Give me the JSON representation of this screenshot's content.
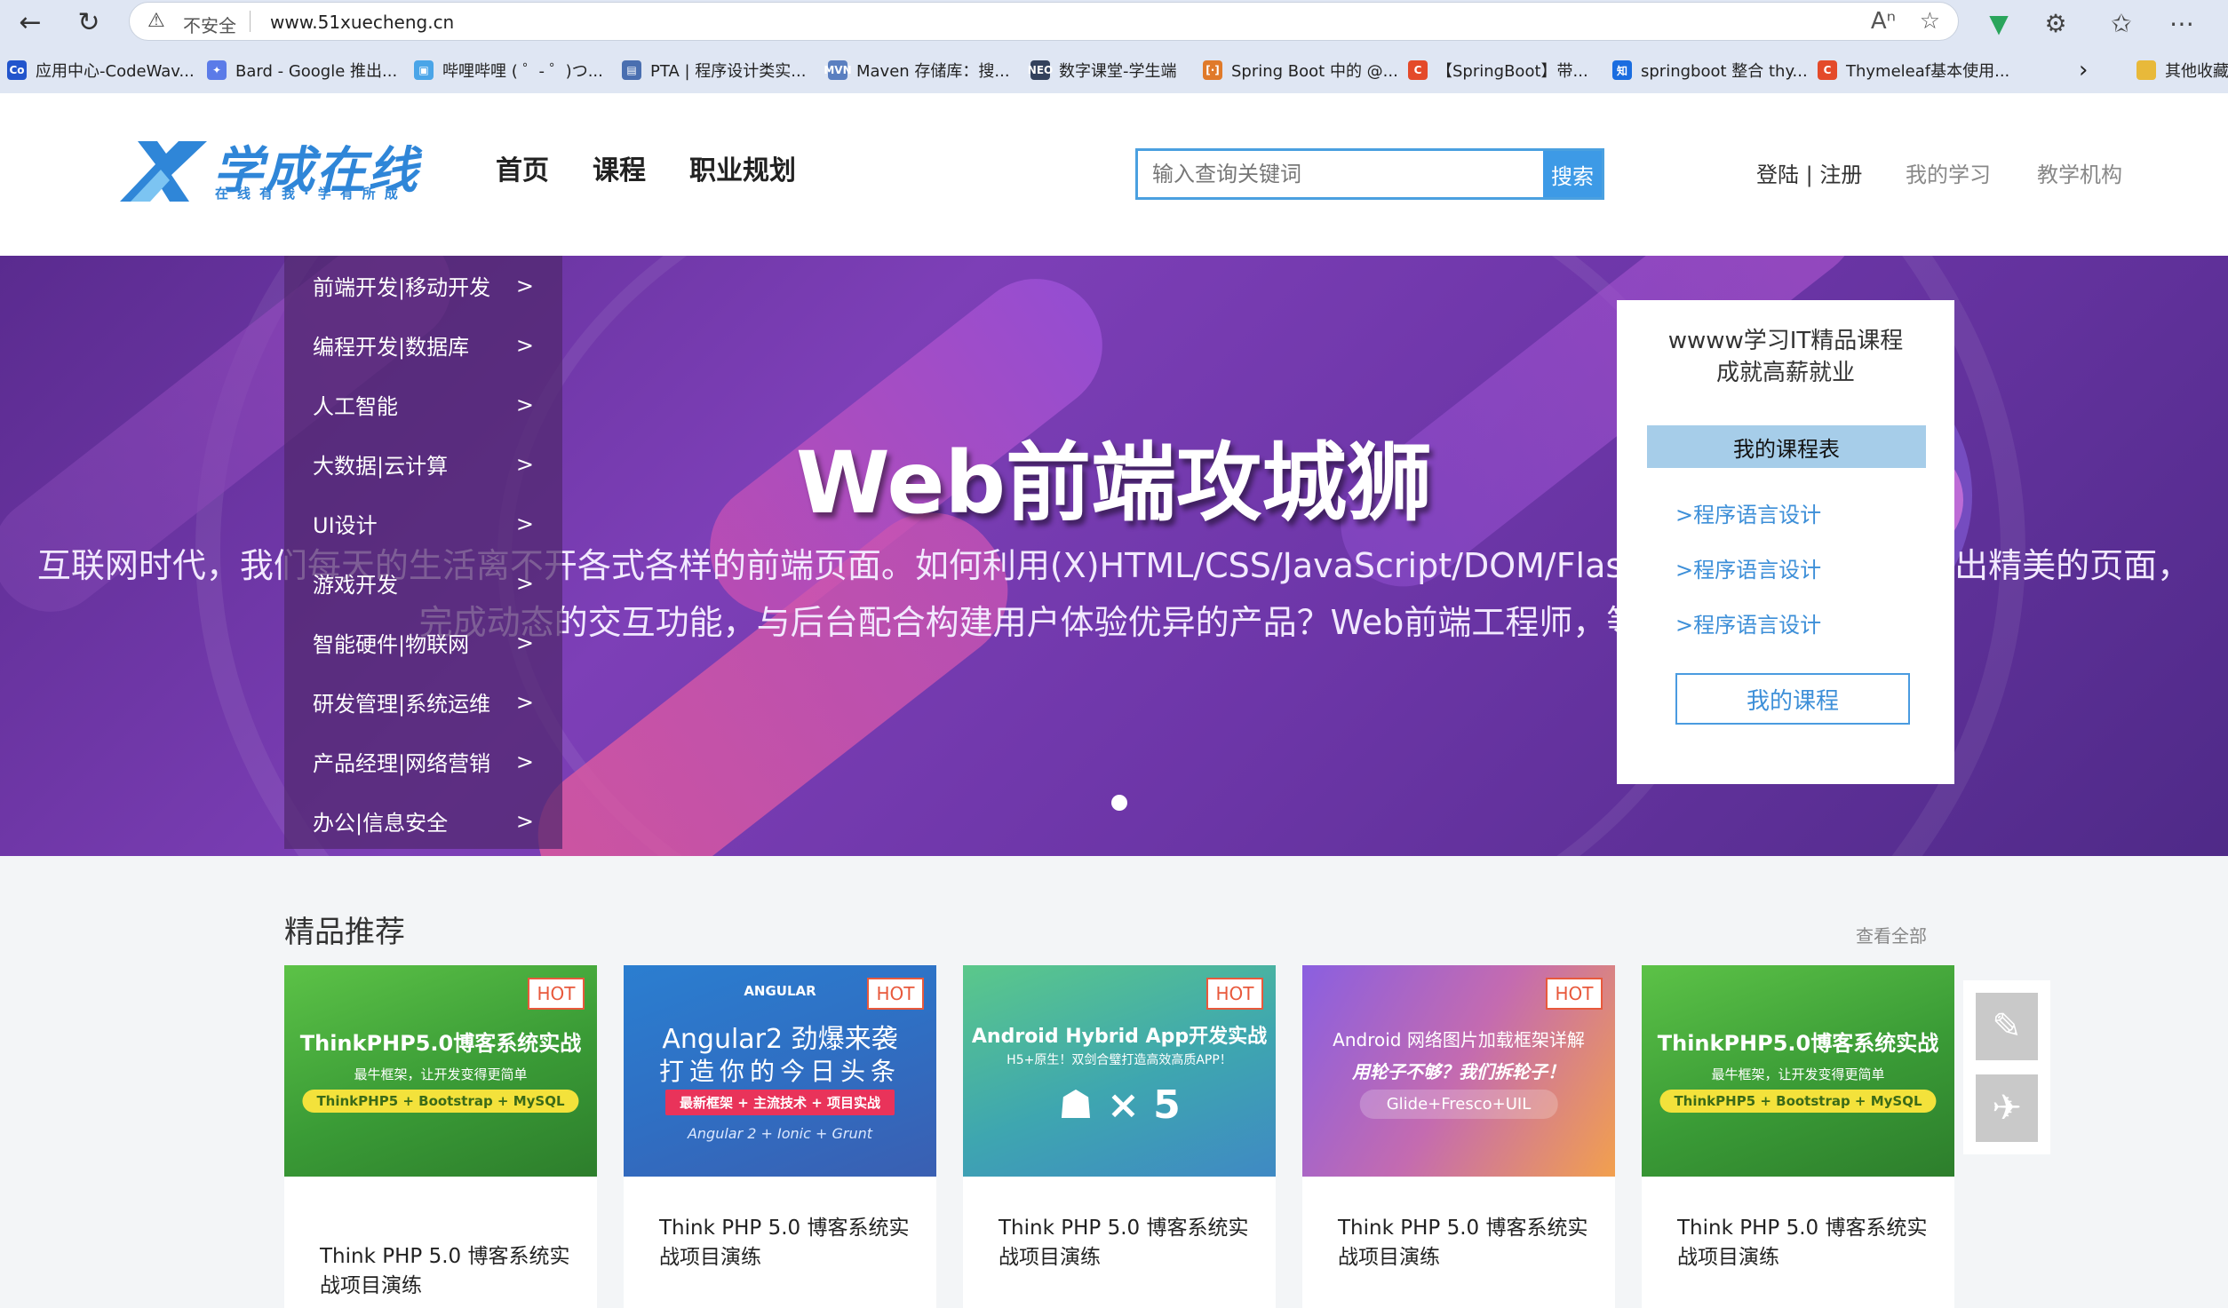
{
  "browser": {
    "insecure_label": "不安全",
    "url": "www.51xuecheng.cn",
    "bookmarks": [
      {
        "icon": "Co",
        "label": "应用中心-CodeWav...",
        "color": "#2255cc"
      },
      {
        "icon": "✦",
        "label": "Bard - Google 推出...",
        "color": "#5b7be8"
      },
      {
        "icon": "▣",
        "label": "哔哩哔哩 ( ゜- ゜)つ...",
        "color": "#4aa5e8"
      },
      {
        "icon": "▤",
        "label": "PTA | 程序设计类实...",
        "color": "#4a6fb0"
      },
      {
        "icon": "MVN",
        "label": "Maven 存储库：搜...",
        "color": "#5a7fc0"
      },
      {
        "icon": "NEO",
        "label": "数字课堂-学生端",
        "color": "#33415c"
      },
      {
        "icon": "[·]",
        "label": "Spring Boot 中的 @...",
        "color": "#e07a2a"
      },
      {
        "icon": "C",
        "label": "【SpringBoot】带...",
        "color": "#e44a2a"
      },
      {
        "icon": "知",
        "label": "springboot 整合 thy...",
        "color": "#1a6de0"
      },
      {
        "icon": "C",
        "label": "Thymeleaf基本使用...",
        "color": "#e44a2a"
      }
    ],
    "other_bookmarks": "其他收藏"
  },
  "header": {
    "logo_text": "学成在线",
    "logo_sub": "在线有我·学有所成",
    "nav": [
      "首页",
      "课程",
      "职业规划"
    ],
    "search_placeholder": "输入查询关键词",
    "search_button": "搜索",
    "login": "登陆 | 注册",
    "my_learning": "我的学习",
    "institution": "教学机构"
  },
  "categories": [
    {
      "label": "前端开发|移动开发",
      "arrow": ">"
    },
    {
      "label": "编程开发|数据库",
      "arrow": ">"
    },
    {
      "label": "人工智能",
      "arrow": ">"
    },
    {
      "label": "大数据|云计算",
      "arrow": ">"
    },
    {
      "label": "UI设计",
      "arrow": ">"
    },
    {
      "label": "游戏开发",
      "arrow": ">"
    },
    {
      "label": "智能硬件|物联网",
      "arrow": ">"
    },
    {
      "label": "研发管理|系统运维",
      "arrow": ">"
    },
    {
      "label": "产品经理|网络营销",
      "arrow": ">"
    },
    {
      "label": "办公|信息安全",
      "arrow": ">"
    }
  ],
  "banner": {
    "title": "Web前端攻城狮",
    "line1": "互联网时代，我们每天的生活离不开各式各样的前端页面。如何利用(X)HTML/CSS/JavaScript/DOM/Flash等各种Web技术搭建出精美的页面，",
    "line2": "完成动态的交互功能，与后台配合构建用户体验优异的产品？Web前端工程师，等你来挑战！"
  },
  "panel": {
    "slogan_1": "wwww学习IT精品课程",
    "slogan_2": "成就高薪就业",
    "schedule": "我的课程表",
    "links": [
      ">程序语言设计",
      ">程序语言设计",
      ">程序语言设计"
    ],
    "my_courses": "我的课程"
  },
  "recommend": {
    "title": "精品推荐",
    "view_all": "查看全部",
    "hot": "HOT",
    "cards": [
      {
        "title": "Think PHP 5.0 博客系统实战项目演练",
        "img_title": "ThinkPHP5.0博客系统实战",
        "img_sub": "最牛框架，让开发变得更简单",
        "img_tag": "ThinkPHP5 + Bootstrap + MySQL"
      },
      {
        "title": "Think PHP 5.0 博客系统实战项目演练",
        "img_brand": "ANGULAR",
        "img_title": "Angular2 劲爆来袭",
        "img_sub": "打造你的今日头条",
        "img_tag": "最新框架 + 主流技术 + 项目实战",
        "img_foot": "Angular 2 + Ionic + Grunt"
      },
      {
        "title": "Think PHP 5.0 博客系统实战项目演练",
        "img_title": "Android Hybrid App开发实战",
        "img_sub": "H5+原生！双剑合璧打造高效高质APP！",
        "img_icons": "× 5"
      },
      {
        "title": "Think PHP 5.0 博客系统实战项目演练",
        "img_title": "Android 网络图片加载框架详解",
        "img_sub": "用轮子不够？我们拆轮子！",
        "img_tag": "Glide+Fresco+UIL"
      },
      {
        "title": "Think PHP 5.0 博客系统实战项目演练",
        "img_title": "ThinkPHP5.0博客系统实战",
        "img_sub": "最牛框架，让开发变得更简单",
        "img_tag": "ThinkPHP5 + Bootstrap + MySQL"
      }
    ]
  }
}
